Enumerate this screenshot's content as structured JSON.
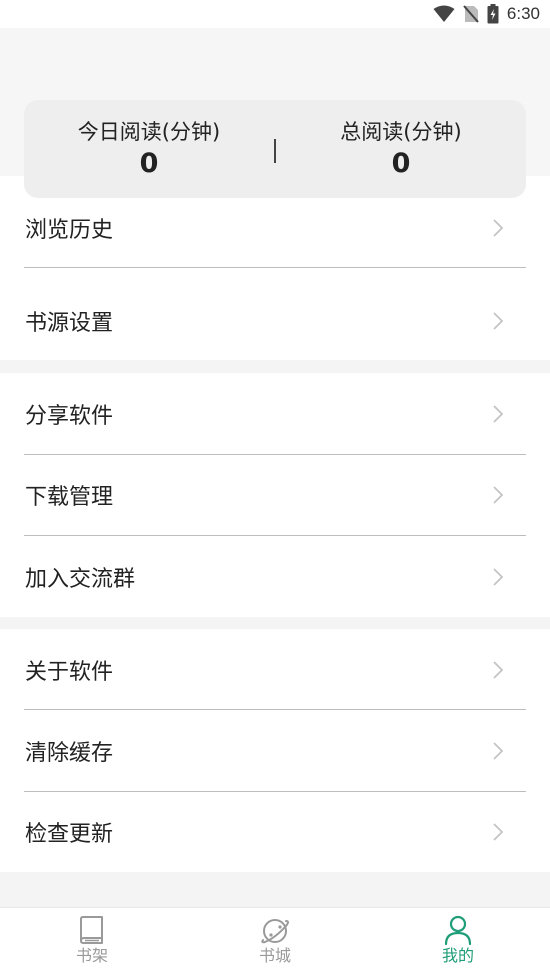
{
  "status_bar": {
    "time": "6:30",
    "wifi_icon": "wifi-icon",
    "signal_icon": "no-sim-icon",
    "battery_icon": "battery-charging-icon"
  },
  "stats": {
    "today_label": "今日阅读(分钟)",
    "today_value": "0",
    "total_label": "总阅读(分钟)",
    "total_value": "0"
  },
  "menu": {
    "history": "浏览历史",
    "book_source": "书源设置",
    "share": "分享软件",
    "downloads": "下载管理",
    "join_group": "加入交流群",
    "about": "关于软件",
    "clear_cache": "清除缓存",
    "check_update": "检查更新"
  },
  "bottom_nav": {
    "items": [
      {
        "label": "书架",
        "icon": "bookshelf-icon"
      },
      {
        "label": "书城",
        "icon": "planet-icon"
      },
      {
        "label": "我的",
        "icon": "person-icon"
      }
    ],
    "active_index": 2,
    "active_color": "#1f9d78",
    "inactive_color": "#9a9a9a"
  }
}
